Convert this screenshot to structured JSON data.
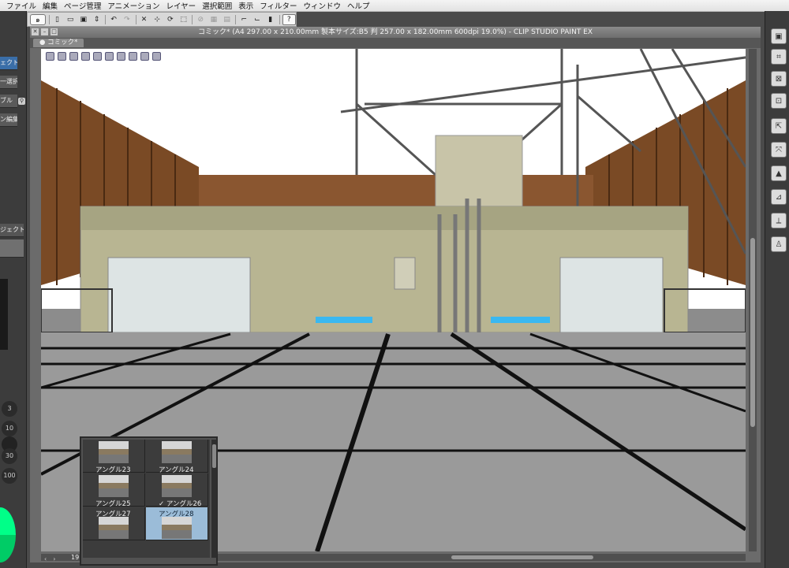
{
  "menubar": {
    "items": [
      "ファイル",
      "編集",
      "ページ管理",
      "アニメーション",
      "レイヤー",
      "選択範囲",
      "表示",
      "フィルター",
      "ウィンドウ",
      "ヘルプ"
    ]
  },
  "toolbar": {
    "icons": [
      "app-logo",
      "new-icon",
      "open-icon",
      "save-icon",
      "menu-icon",
      "undo-icon",
      "redo-icon",
      "clear-icon",
      "transform-icon",
      "rotate-icon",
      "select-icon",
      "deselect-icon",
      "invert-icon",
      "snap-ruler-icon",
      "snap-special-icon",
      "snap-grid-icon",
      "help-icon"
    ]
  },
  "document": {
    "title": "コミック* (A4 297.00 x 210.00mm 製本サイズ:B5 判 257.00 x 182.00mm 600dpi 19.0%) - CLIP STUDIO PAINT EX",
    "tab_label": "コミック*",
    "zoom": "19.0"
  },
  "left_panel": {
    "buttons": [
      "ェクト",
      "一選択",
      "ブル",
      "ン編集"
    ],
    "object_tab": "ジェクト",
    "brush_sizes": [
      "3",
      "30",
      "10",
      "100"
    ]
  },
  "angle_palette": {
    "items": [
      {
        "label": "アングル23",
        "selected": false
      },
      {
        "label": "アングル24",
        "selected": false
      },
      {
        "label": "アングル25",
        "selected": false
      },
      {
        "label": "✓ アングル26",
        "selected": true
      },
      {
        "label": "アングル27",
        "selected": false
      },
      {
        "label": "アングル28",
        "selected": false
      }
    ]
  },
  "colors": {
    "panel": "#3c3c3c",
    "accent": "#3a6ea8",
    "selected_cell": "#9bbcd8"
  }
}
